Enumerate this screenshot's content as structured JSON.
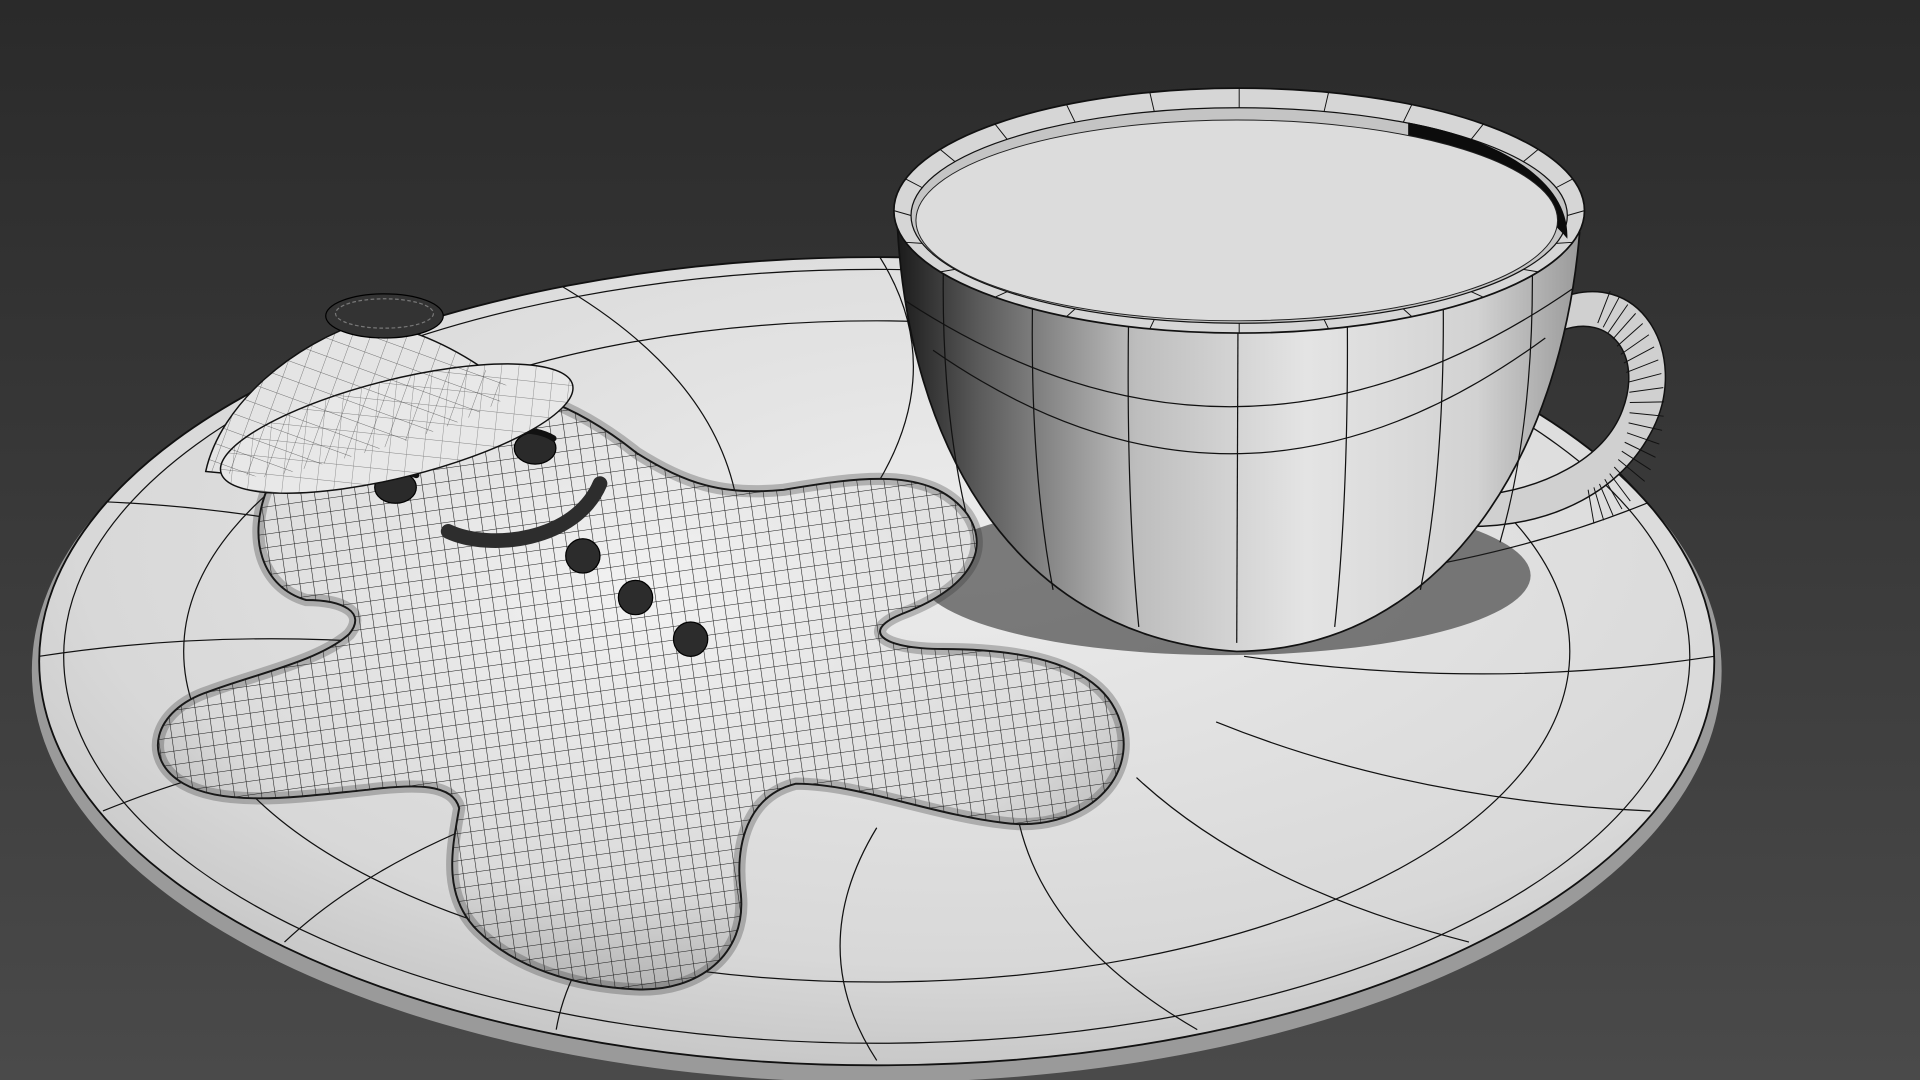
{
  "viewport": {
    "shading_mode": "edged-faces",
    "colors": {
      "background_top": "#2a2a2a",
      "background_bottom": "#4a4a4a",
      "surface_light": "#e2e2e2",
      "surface_mid": "#bdbdbd",
      "surface_dark": "#6e6e6e",
      "wire": "#111111",
      "shadow": "#0a0a0a"
    }
  },
  "scene": {
    "objects": [
      {
        "name": "saucer",
        "icon": "plate-object"
      },
      {
        "name": "teacup",
        "icon": "cup-object"
      },
      {
        "name": "cup-handle",
        "icon": "handle-object"
      },
      {
        "name": "gingerbread-man",
        "icon": "cookie-object"
      },
      {
        "name": "santa-hat",
        "icon": "hat-object"
      }
    ]
  }
}
